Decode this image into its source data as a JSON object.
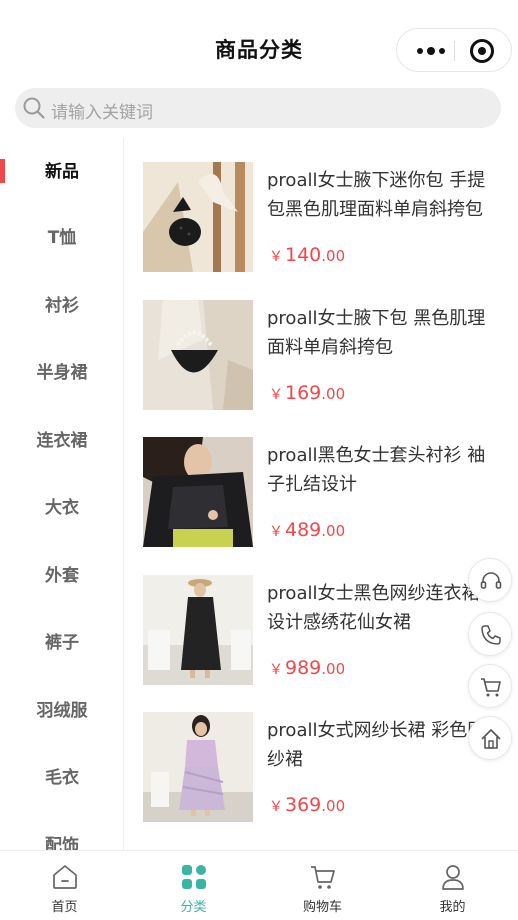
{
  "header": {
    "title": "商品分类"
  },
  "search": {
    "placeholder": "请输入关键词"
  },
  "categories": [
    {
      "label": "新品",
      "active": true
    },
    {
      "label": "T恤"
    },
    {
      "label": "衬衫"
    },
    {
      "label": "半身裙"
    },
    {
      "label": "连衣裙"
    },
    {
      "label": "大衣"
    },
    {
      "label": "外套"
    },
    {
      "label": "裤子"
    },
    {
      "label": "羽绒服"
    },
    {
      "label": "毛衣"
    },
    {
      "label": "配饰"
    }
  ],
  "products": [
    {
      "name": "proall女士腋下迷你包 手提包黑色肌理面料单肩斜挎包",
      "currency": "￥",
      "price_int": "140",
      "price_dec": ".00"
    },
    {
      "name": "proall女士腋下包 黑色肌理面料单肩斜挎包",
      "currency": "￥",
      "price_int": "169",
      "price_dec": ".00"
    },
    {
      "name": "proall黑色女士套头衬衫 袖子扎结设计",
      "currency": "￥",
      "price_int": "489",
      "price_dec": ".00"
    },
    {
      "name": "proall女士黑色网纱连衣裙 设计感绣花仙女裙",
      "currency": "￥",
      "price_int": "989",
      "price_dec": ".00"
    },
    {
      "name": "proall女式网纱长裙 彩色网纱裙",
      "currency": "￥",
      "price_int": "369",
      "price_dec": ".00"
    }
  ],
  "floating": [
    "headset-icon",
    "phone-icon",
    "cart-icon",
    "home-icon"
  ],
  "tabbar": [
    {
      "label": "首页",
      "icon": "home-icon"
    },
    {
      "label": "分类",
      "icon": "category-icon",
      "active": true
    },
    {
      "label": "购物车",
      "icon": "cart-icon"
    },
    {
      "label": "我的",
      "icon": "user-icon"
    }
  ],
  "colors": {
    "accent": "#f0474a",
    "tab_active": "#3ab5a4",
    "search_bg": "#eeeeee"
  }
}
